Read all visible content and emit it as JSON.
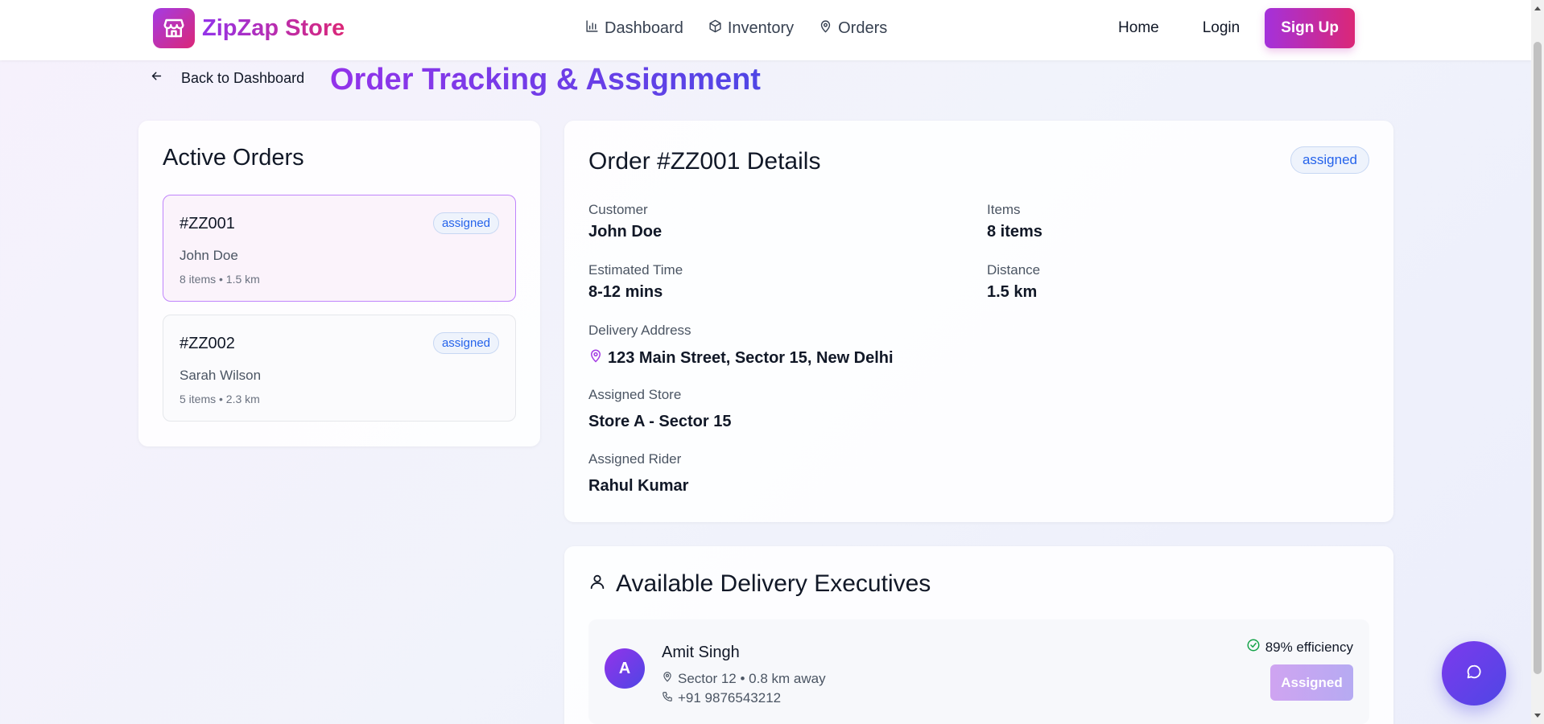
{
  "header": {
    "brand": "ZipZap Store",
    "brand_icon": "store-icon",
    "nav": [
      {
        "label": "Dashboard",
        "icon": "bar-chart-icon"
      },
      {
        "label": "Inventory",
        "icon": "package-icon"
      },
      {
        "label": "Orders",
        "icon": "map-pin-icon"
      }
    ],
    "home_label": "Home",
    "login_label": "Login",
    "signup_label": "Sign Up"
  },
  "page": {
    "back_label": "Back to Dashboard",
    "title": "Order Tracking & Assignment"
  },
  "orders": {
    "title": "Active Orders",
    "items": [
      {
        "id": "#ZZ001",
        "status": "assigned",
        "customer": "John Doe",
        "meta": "8 items • 1.5 km",
        "selected": true
      },
      {
        "id": "#ZZ002",
        "status": "assigned",
        "customer": "Sarah Wilson",
        "meta": "5 items • 2.3 km",
        "selected": false
      }
    ]
  },
  "details": {
    "title": "Order #ZZ001 Details",
    "status": "assigned",
    "customer_label": "Customer",
    "customer": "John Doe",
    "items_label": "Items",
    "items": "8 items",
    "time_label": "Estimated Time",
    "time": "8-12 mins",
    "distance_label": "Distance",
    "distance": "1.5 km",
    "address_label": "Delivery Address",
    "address": "123 Main Street, Sector 15, New Delhi",
    "store_label": "Assigned Store",
    "store": "Store A - Sector 15",
    "rider_label": "Assigned Rider",
    "rider": "Rahul Kumar"
  },
  "executives": {
    "title": "Available Delivery Executives",
    "list": [
      {
        "initial": "A",
        "name": "Amit Singh",
        "location": "Sector 12 • 0.8 km away",
        "phone": "+91 9876543212",
        "efficiency": "89% efficiency",
        "action_label": "Assigned"
      }
    ]
  },
  "colors": {
    "brand_gradient_start": "#9333ea",
    "brand_gradient_end": "#db2777",
    "title_gradient_end": "#4f46e5",
    "badge_text": "#2563eb",
    "success": "#16a34a"
  }
}
